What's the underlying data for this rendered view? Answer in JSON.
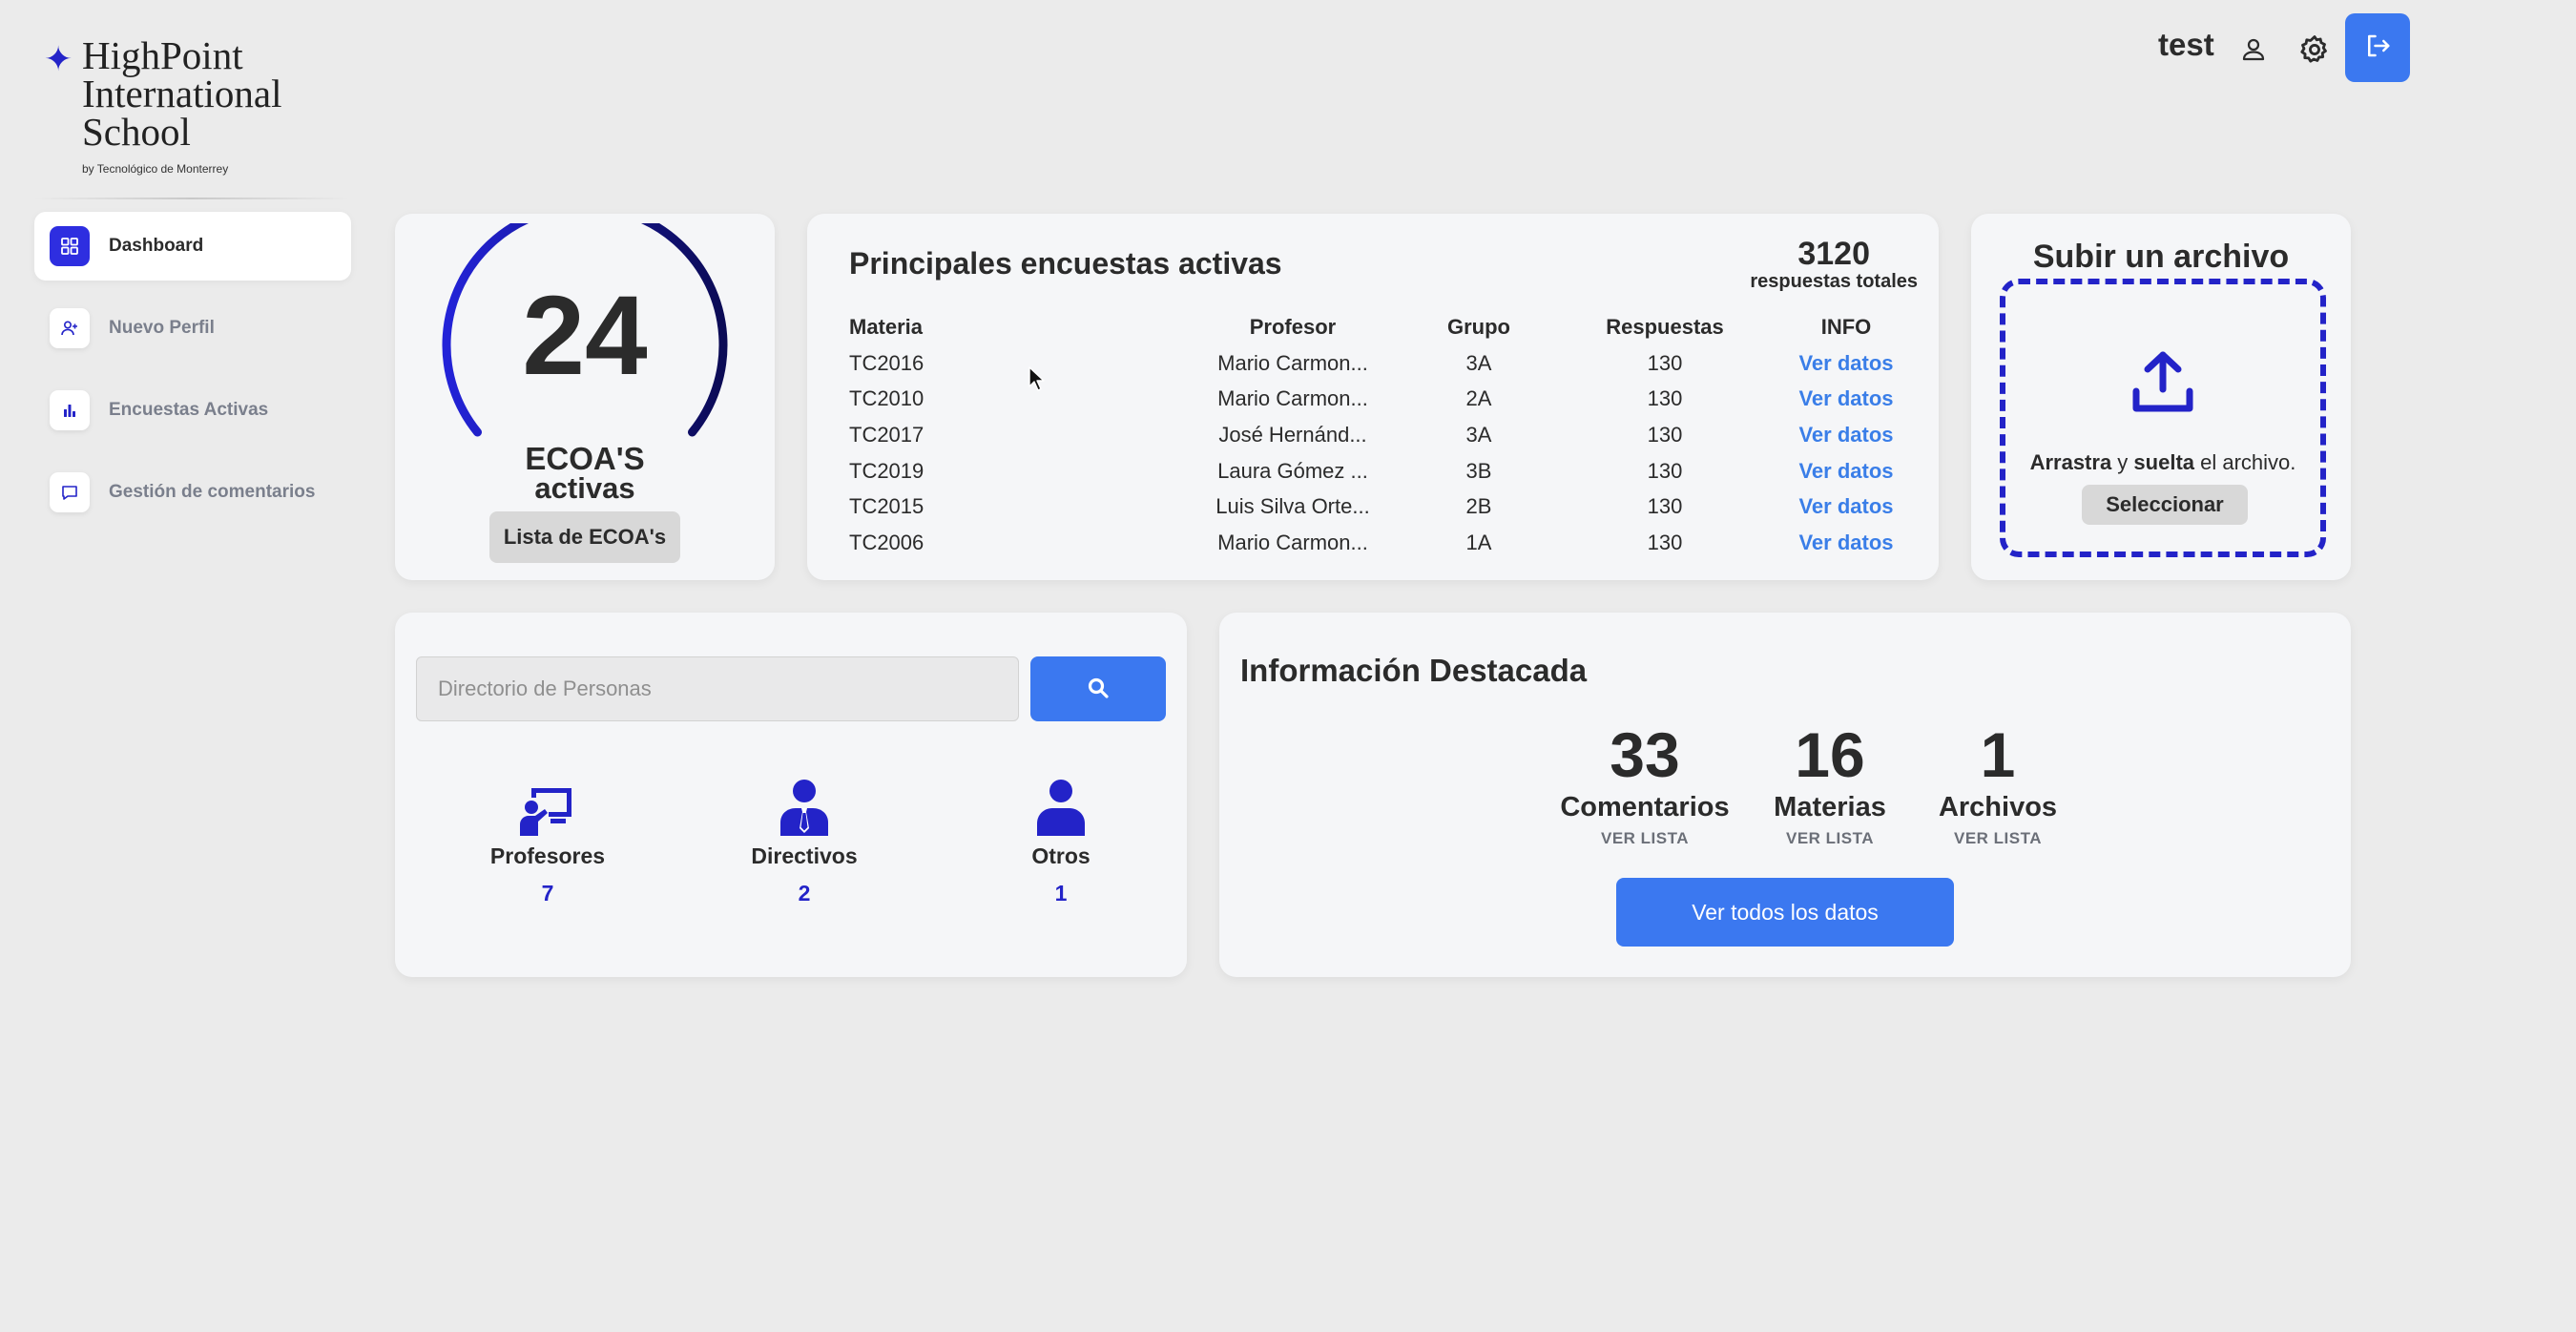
{
  "brand": {
    "line1": "HighPoint",
    "line2": "International",
    "line3": "School",
    "tagline": "by Tecnológico de Monterrey",
    "accent_color": "#2323c8"
  },
  "header": {
    "username": "test",
    "icons": [
      "user-icon",
      "gear-icon",
      "logout-icon"
    ]
  },
  "sidebar": {
    "items": [
      {
        "label": "Dashboard",
        "icon": "grid-icon",
        "active": true
      },
      {
        "label": "Nuevo Perfil",
        "icon": "add-user-icon",
        "active": false
      },
      {
        "label": "Encuestas Activas",
        "icon": "bar-chart-icon",
        "active": false
      },
      {
        "label": "Gestión de comentarios",
        "icon": "comment-icon",
        "active": false
      }
    ]
  },
  "gauge": {
    "value": "24",
    "label_line1": "ECOA'S",
    "label_line2": "activas",
    "button_label": "Lista de ECOA's"
  },
  "surveys": {
    "title": "Principales encuestas activas",
    "total_value": "3120",
    "total_label": "respuestas totales",
    "columns": [
      "Materia",
      "Profesor",
      "Grupo",
      "Respuestas",
      "INFO"
    ],
    "rows": [
      {
        "materia": "TC2016",
        "profesor": "Mario Carmon...",
        "grupo": "3A",
        "respuestas": "130",
        "info": "Ver datos"
      },
      {
        "materia": "TC2010",
        "profesor": "Mario Carmon...",
        "grupo": "2A",
        "respuestas": "130",
        "info": "Ver datos"
      },
      {
        "materia": "TC2017",
        "profesor": "José Hernánd...",
        "grupo": "3A",
        "respuestas": "130",
        "info": "Ver datos"
      },
      {
        "materia": "TC2019",
        "profesor": "Laura Gómez ...",
        "grupo": "3B",
        "respuestas": "130",
        "info": "Ver datos"
      },
      {
        "materia": "TC2015",
        "profesor": "Luis Silva Orte...",
        "grupo": "2B",
        "respuestas": "130",
        "info": "Ver datos"
      },
      {
        "materia": "TC2006",
        "profesor": "Mario Carmon...",
        "grupo": "1A",
        "respuestas": "130",
        "info": "Ver datos"
      }
    ]
  },
  "upload": {
    "title": "Subir un archivo",
    "drag_bold": "Arrastra",
    "and": " y ",
    "drop_bold": "suelta",
    "suffix": " el archivo.",
    "button_label": "Seleccionar"
  },
  "directory": {
    "placeholder": "Directorio de Personas",
    "categories": [
      {
        "label": "Profesores",
        "count": "7",
        "icon": "teacher-icon"
      },
      {
        "label": "Directivos",
        "count": "2",
        "icon": "executive-icon"
      },
      {
        "label": "Otros",
        "count": "1",
        "icon": "person-icon"
      }
    ]
  },
  "highlights": {
    "title": "Información Destacada",
    "stats": [
      {
        "value": "33",
        "label": "Comentarios",
        "link": "VER LISTA"
      },
      {
        "value": "16",
        "label": "Materias",
        "link": "VER LISTA"
      },
      {
        "value": "1",
        "label": "Archivos",
        "link": "VER LISTA"
      }
    ],
    "button_label": "Ver todos los datos"
  },
  "colors": {
    "primary_blue": "#3b78f0",
    "accent_indigo": "#2323c8",
    "link_blue": "#3a7ee8",
    "background": "#ebebeb",
    "card": "#f5f6f8"
  }
}
